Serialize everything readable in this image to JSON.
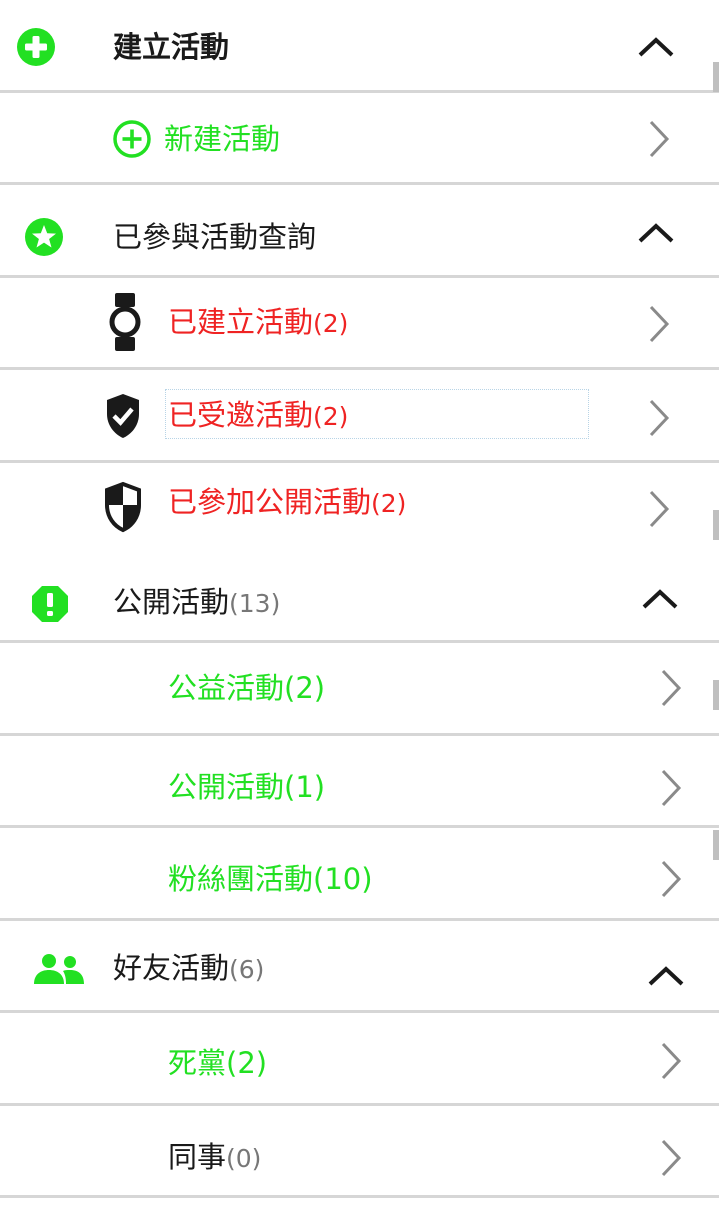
{
  "colors": {
    "green": "#22e022",
    "red": "#ef2323",
    "dark": "#1a1a1a",
    "gray": "#777777",
    "divider": "#d6d6d6",
    "chevron": "#8a8a8a"
  },
  "sections": {
    "create": {
      "title": "建立活動",
      "icon": "plus-circle-filled-icon",
      "items": [
        {
          "label": "新建活動",
          "icon": "plus-circle-outline-icon"
        }
      ]
    },
    "joined": {
      "title": "已參與活動查詢",
      "icon": "star-circle-icon",
      "items": [
        {
          "label": "已建立活動",
          "count": "(2)",
          "icon": "watch-icon"
        },
        {
          "label": "已受邀活動",
          "count": "(2)",
          "icon": "shield-check-icon"
        },
        {
          "label": "已參加公開活動",
          "count": "(2)",
          "icon": "shield-half-icon"
        }
      ]
    },
    "public": {
      "title": "公開活動",
      "count": "(13)",
      "icon": "alert-octagon-icon",
      "items": [
        {
          "label": "公益活動(2)"
        },
        {
          "label": "公開活動(1)"
        },
        {
          "label": "粉絲團活動(10)"
        }
      ]
    },
    "friends": {
      "title": "好友活動",
      "count": "(6)",
      "icon": "people-icon",
      "items": [
        {
          "label": "死黨(2)"
        },
        {
          "label": "同事",
          "count": "(0)"
        }
      ]
    }
  }
}
